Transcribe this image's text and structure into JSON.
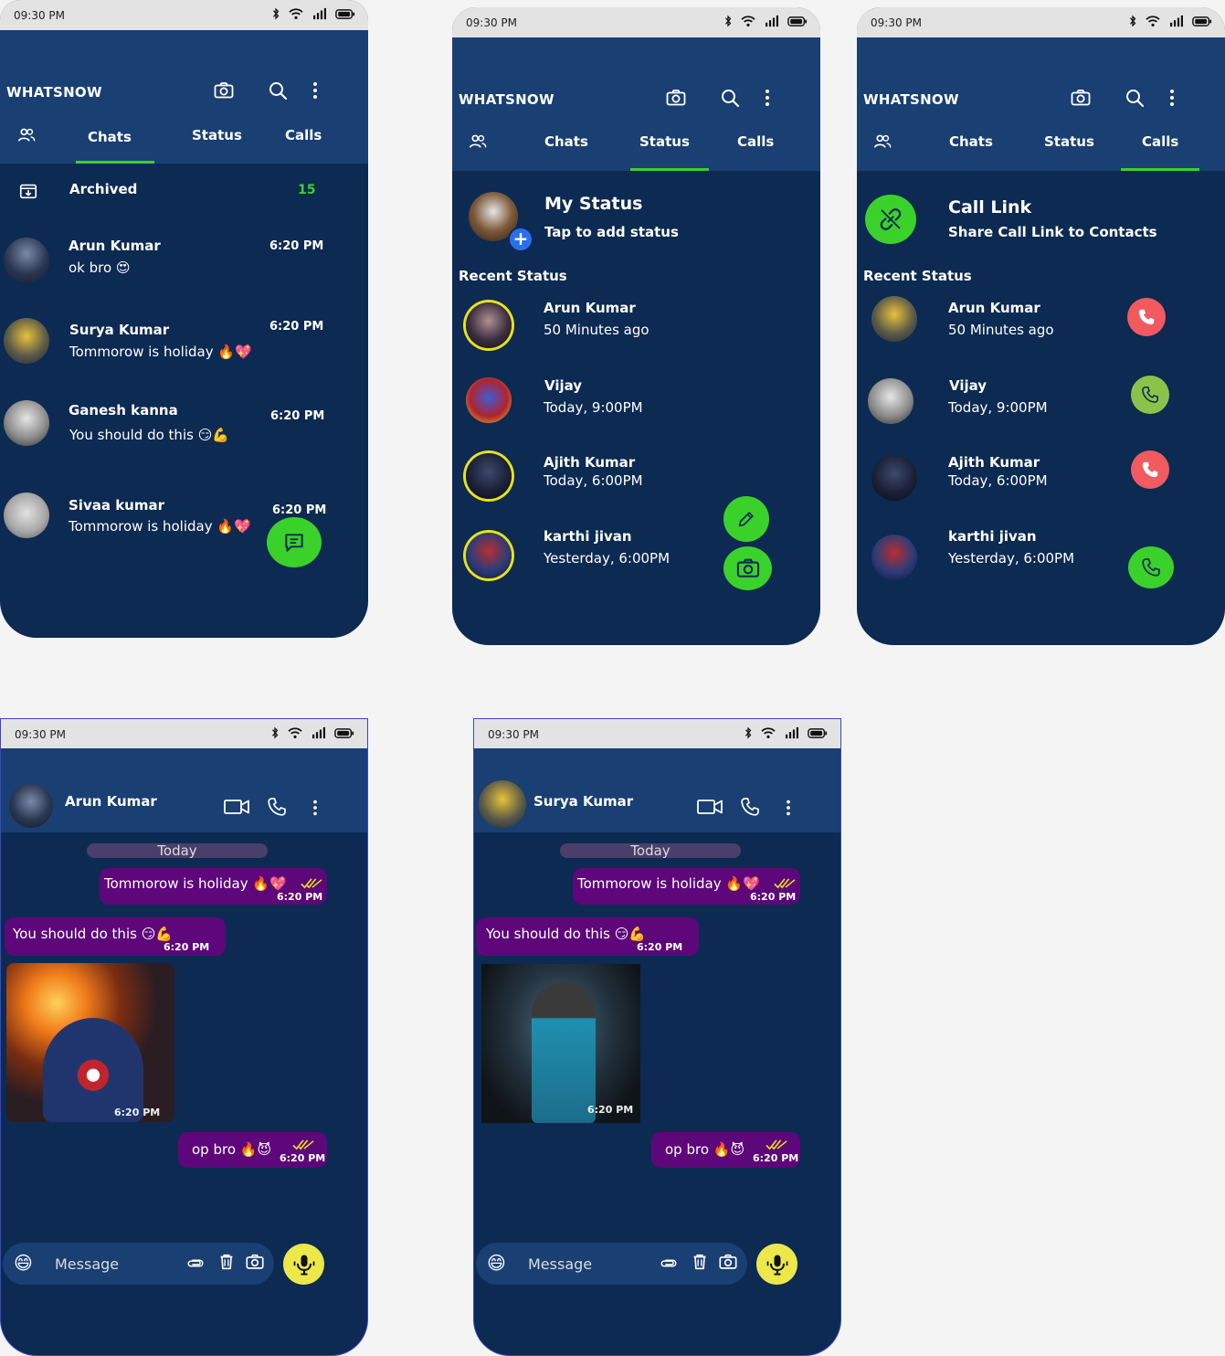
{
  "status_bar": {
    "time": "09:30 PM"
  },
  "app_title": "WHATSNOW",
  "tabs": {
    "chats": "Chats",
    "status": "Status",
    "calls": "Calls"
  },
  "chats_screen": {
    "archived": {
      "label": "Archived",
      "count": "15"
    },
    "items": [
      {
        "name": "Arun Kumar",
        "message": "ok bro 😍",
        "time": "6:20 PM"
      },
      {
        "name": "Surya Kumar",
        "message": "Tommorow is holiday 🔥💖",
        "time": "6:20 PM"
      },
      {
        "name": "Ganesh kanna",
        "message": "You should  do this 😏💪",
        "time": "6:20 PM"
      },
      {
        "name": "Sivaa kumar",
        "message": "Tommorow is holiday 🔥💖",
        "time": "6:20 PM"
      }
    ]
  },
  "status_screen": {
    "my_status": {
      "title": "My Status",
      "subtitle": "Tap to add status"
    },
    "section": "Recent Status",
    "items": [
      {
        "name": "Arun Kumar",
        "time": "50 Minutes ago"
      },
      {
        "name": "Vijay",
        "time": "Today, 9:00PM"
      },
      {
        "name": "Ajith Kumar",
        "time": "Today, 6:00PM"
      },
      {
        "name": "karthi jivan",
        "time": "Yesterday, 6:00PM"
      }
    ]
  },
  "calls_screen": {
    "call_link": {
      "title": "Call Link",
      "subtitle": "Share Call Link to Contacts"
    },
    "section": "Recent Status",
    "items": [
      {
        "name": "Arun Kumar",
        "time": "50 Minutes ago",
        "type": "missed"
      },
      {
        "name": "Vijay",
        "time": "Today, 9:00PM",
        "type": "received"
      },
      {
        "name": "Ajith Kumar",
        "time": "Today, 6:00PM",
        "type": "missed"
      },
      {
        "name": "karthi jivan",
        "time": "Yesterday, 6:00PM",
        "type": "received"
      }
    ]
  },
  "chat_arun": {
    "contact": "Arun Kumar",
    "date": "Today",
    "msg1": "Tommorow is holiday 🔥💖",
    "msg1_time": "6:20 PM",
    "msg2": "You should  do this 😏💪",
    "msg2_time": "6:20 PM",
    "image_time": "6:20 PM",
    "msg3": "op bro 🔥😈",
    "msg3_time": "6:20 PM",
    "input_placeholder": "Message"
  },
  "chat_surya": {
    "contact": "Surya Kumar",
    "date": "Today",
    "msg1": "Tommorow is holiday 🔥💖",
    "msg1_time": "6:20 PM",
    "msg2": "You should  do this 😏💪",
    "msg2_time": "6:20 PM",
    "image_time": "6:20 PM",
    "msg3": "op bro 🔥😈",
    "msg3_time": "6:20 PM",
    "input_placeholder": "Message"
  },
  "colors": {
    "bg_dark": "#0c2a52",
    "bar": "#193f73",
    "accent_green": "#3bd12b",
    "bubble": "#5d077a",
    "missed_red": "#f15a5f",
    "received_green": "#8bc34a",
    "mic_yellow": "#ece84a",
    "ring_yellow": "#e7e21c"
  }
}
